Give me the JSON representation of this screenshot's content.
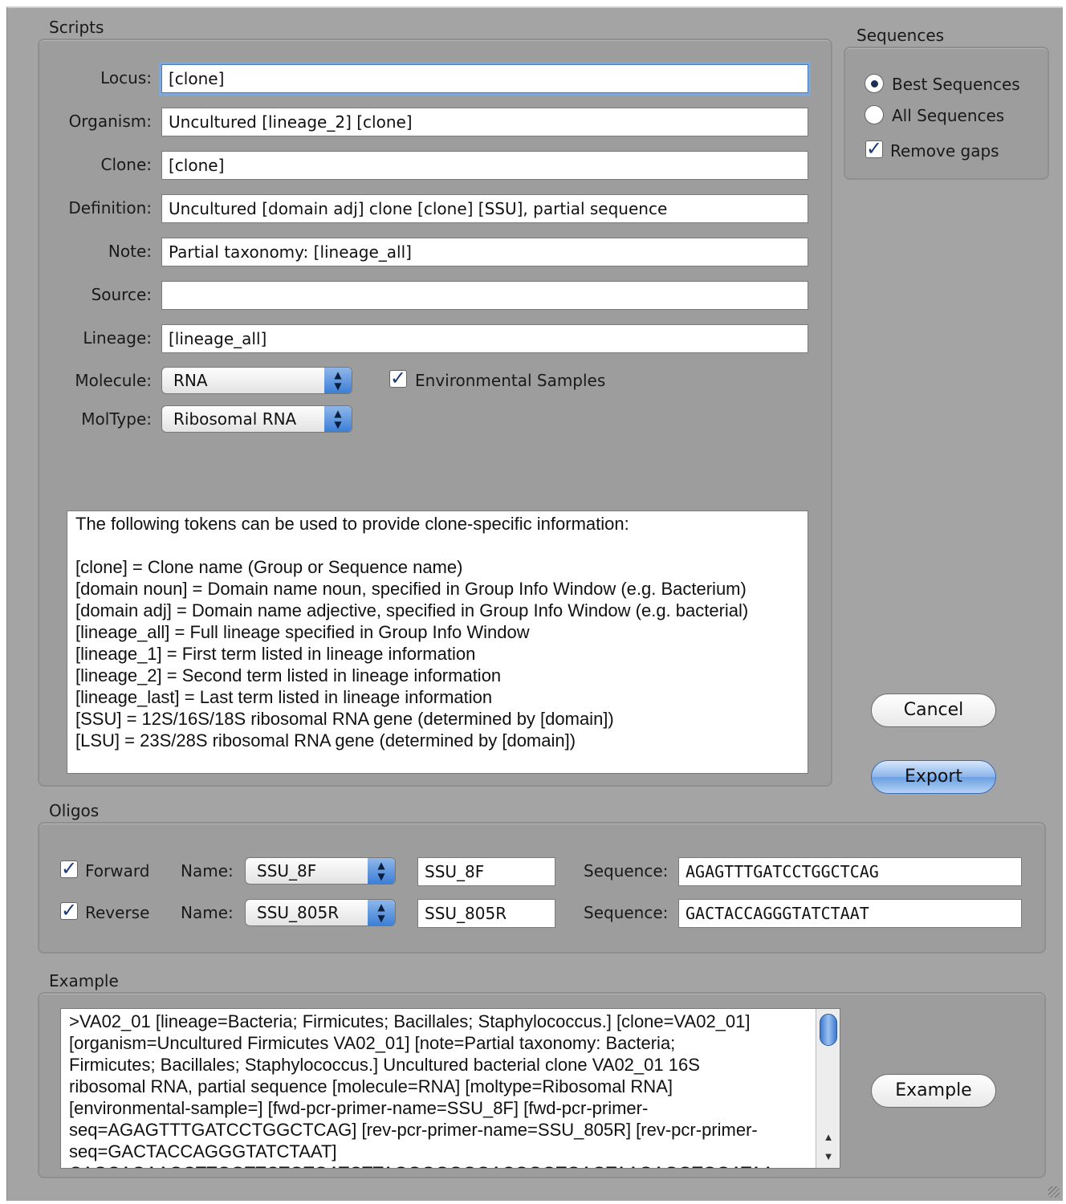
{
  "scripts": {
    "label": "Scripts",
    "fields": [
      {
        "label": "Locus:",
        "value": "[clone]"
      },
      {
        "label": "Organism:",
        "value": "Uncultured [lineage_2] [clone]"
      },
      {
        "label": "Clone:",
        "value": "[clone]"
      },
      {
        "label": "Definition:",
        "value": "Uncultured [domain adj] clone [clone] [SSU], partial sequence"
      },
      {
        "label": "Note:",
        "value": "Partial taxonomy:  [lineage_all]"
      },
      {
        "label": "Source:",
        "value": ""
      },
      {
        "label": "Lineage:",
        "value": "[lineage_all]"
      }
    ],
    "molecule": {
      "label": "Molecule:",
      "value": "RNA"
    },
    "moltype": {
      "label": "MolType:",
      "value": "Ribosomal RNA"
    },
    "environmental_samples": {
      "label": "Environmental Samples",
      "checked": true
    },
    "help_text": [
      "The following tokens can be used to provide clone-specific information:",
      "",
      "[clone] = Clone name (Group or Sequence name)",
      "[domain noun] = Domain name noun, specified in Group Info Window (e.g. Bacterium)",
      "[domain adj] = Domain name adjective, specified in Group Info Window (e.g. bacterial)",
      "[lineage_all] = Full lineage specified in Group Info Window",
      "[lineage_1] = First term listed in lineage information",
      "[lineage_2] = Second term listed in lineage information",
      "[lineage_last] = Last term listed in lineage information",
      "[SSU] = 12S/16S/18S ribosomal RNA gene (determined by [domain])",
      "[LSU] = 23S/28S ribosomal RNA gene (determined by [domain])"
    ]
  },
  "sequences": {
    "label": "Sequences",
    "best": {
      "label": "Best Sequences",
      "selected": true
    },
    "all": {
      "label": "All Sequences",
      "selected": false
    },
    "remove_gaps": {
      "label": "Remove gaps",
      "checked": true
    }
  },
  "buttons": {
    "cancel": "Cancel",
    "export": "Export",
    "example": "Example"
  },
  "oligos": {
    "label": "Oligos",
    "name_label": "Name:",
    "sequence_label": "Sequence:",
    "forward": {
      "label": "Forward",
      "checked": true,
      "popup": "SSU_8F",
      "name": "SSU_8F",
      "sequence": "AGAGTTTGATCCTGGCTCAG"
    },
    "reverse": {
      "label": "Reverse",
      "checked": true,
      "popup": "SSU_805R",
      "name": "SSU_805R",
      "sequence": "GACTACCAGGGTATCTAAT"
    }
  },
  "example": {
    "label": "Example",
    "lines": [
      ">VA02_01 [lineage=Bacteria; Firmicutes; Bacillales; Staphylococcus.] [clone=VA02_01]",
      "[organism=Uncultured  Firmicutes VA02_01] [note=Partial taxonomy:  Bacteria;",
      "Firmicutes; Bacillales; Staphylococcus.] Uncultured bacterial clone VA02_01 16S",
      "ribosomal RNA, partial sequence [molecule=RNA] [moltype=Ribosomal RNA]",
      "[environmental-sample=] [fwd-pcr-primer-name=SSU_8F] [fwd-pcr-primer-",
      "seq=AGAGTTTGATCCTGGCTCAG] [rev-pcr-primer-name=SSU_805R] [rev-pcr-primer-",
      "seq=GACTACCAGGGTATCTAAT]",
      "CAGCAGAAGCTTGGTTCTGTGATCTTAGGGGGGGACGGGTGAGTAAGAGGTGGATAA"
    ]
  }
}
